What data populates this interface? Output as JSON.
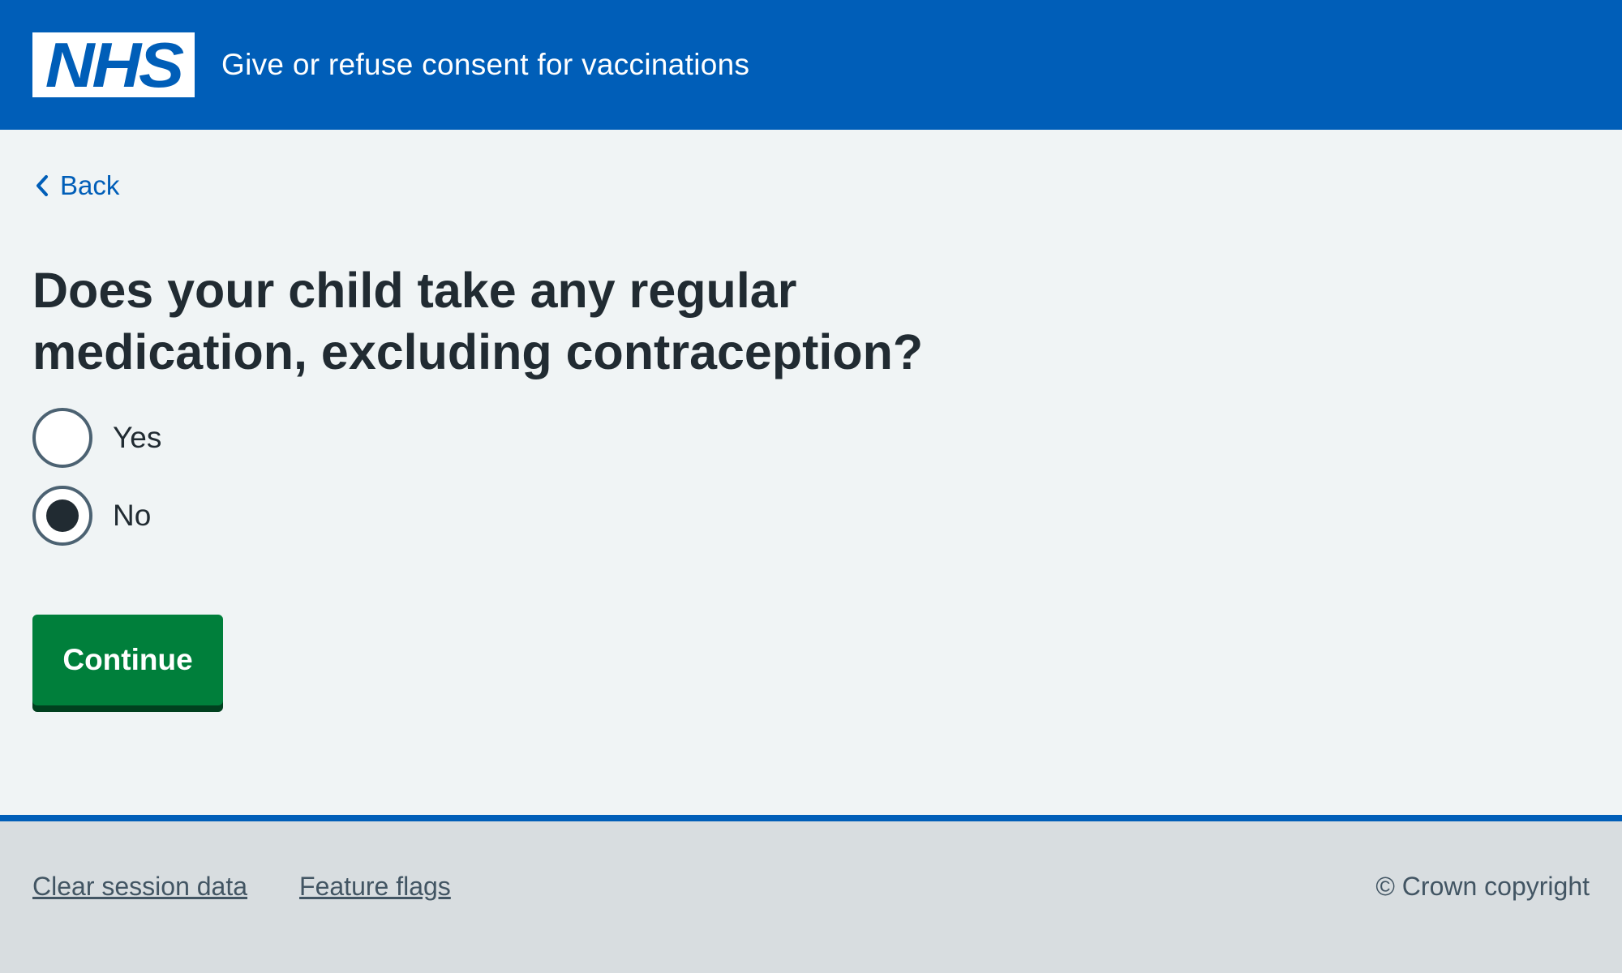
{
  "header": {
    "logo_text": "NHS",
    "service_name": "Give or refuse consent for vaccinations",
    "brand_color": "#005eb8"
  },
  "back_link": {
    "label": "Back",
    "icon": "chevron-left-icon"
  },
  "question": {
    "title": "Does your child take any regular medication, excluding contraception?"
  },
  "options": [
    {
      "label": "Yes",
      "selected": false
    },
    {
      "label": "No",
      "selected": true
    }
  ],
  "continue_button": {
    "label": "Continue",
    "color": "#007f3b"
  },
  "footer": {
    "links": [
      {
        "label": "Clear session data"
      },
      {
        "label": "Feature flags"
      }
    ],
    "copyright": "© Crown copyright"
  }
}
